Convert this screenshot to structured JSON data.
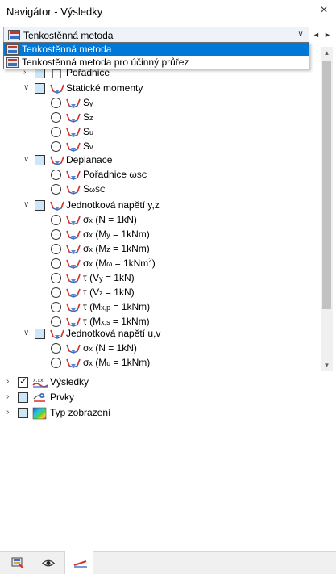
{
  "window": {
    "title": "Navigátor - Výsledky",
    "close_glyph": "×"
  },
  "combo": {
    "selected": "Tenkostěnná metoda",
    "dropdown_glyph": "∨",
    "prev_glyph": "◄",
    "next_glyph": "►"
  },
  "dropdown": {
    "options": [
      {
        "label": "Tenkostěnná metoda",
        "selected": true
      },
      {
        "label": "Tenkostěnná metoda pro účinný průřez",
        "selected": false
      }
    ]
  },
  "tree": {
    "poradnice": "Pořadnice",
    "staticke_momenty": {
      "label": "Statické momenty",
      "items": [
        {
          "main": "S",
          "sub": "y"
        },
        {
          "main": "S",
          "sub": "z"
        },
        {
          "main": "S",
          "sub": "u"
        },
        {
          "main": "S",
          "sub": "v"
        }
      ]
    },
    "deplanace": {
      "label": "Deplanace",
      "items": [
        {
          "text": "Pořadnice ω",
          "sub": "SC"
        },
        {
          "text": "S",
          "sub": "ωSC"
        }
      ]
    },
    "jednotkova_yz": {
      "label": "Jednotková napětí y,z",
      "items": [
        {
          "pre": "σ",
          "psub": "x",
          "a": " (N = 1kN)",
          "asub": "",
          "b": ""
        },
        {
          "pre": "σ",
          "psub": "x",
          "a": " (M",
          "asub": "y",
          "b": " = 1kNm)"
        },
        {
          "pre": "σ",
          "psub": "x",
          "a": " (M",
          "asub": "z",
          "b": " = 1kNm)"
        },
        {
          "pre": "σ",
          "psub": "x",
          "a": " (M",
          "asub": "ω",
          "b": " = 1kNm",
          "sup": "2",
          "c": ")"
        },
        {
          "pre": "τ",
          "psub": "",
          "a": " (V",
          "asub": "y",
          "b": " = 1kN)"
        },
        {
          "pre": "τ",
          "psub": "",
          "a": " (V",
          "asub": "z",
          "b": " = 1kN)"
        },
        {
          "pre": "τ",
          "psub": "",
          "a": " (M",
          "asub": "x,p",
          "b": " = 1kNm)"
        },
        {
          "pre": "τ",
          "psub": "",
          "a": " (M",
          "asub": "x,s",
          "b": " = 1kNm)"
        }
      ]
    },
    "jednotkova_uv": {
      "label": "Jednotková napětí u,v",
      "items": [
        {
          "pre": "σ",
          "psub": "x",
          "a": " (N = 1kN)",
          "asub": "",
          "b": ""
        },
        {
          "pre": "σ",
          "psub": "x",
          "a": " (M",
          "asub": "u",
          "b": " = 1kNm)"
        }
      ]
    }
  },
  "root_items": [
    {
      "label": "Výsledky",
      "checked": true,
      "icon": "results-icon",
      "icon_text": "x.xx"
    },
    {
      "label": "Prvky",
      "checked": false,
      "icon": "elements-icon"
    },
    {
      "label": "Typ zobrazení",
      "checked": false,
      "icon": "display-type-icon"
    }
  ],
  "tabs": [
    {
      "name": "data-tab",
      "active": false
    },
    {
      "name": "view-tab",
      "active": false
    },
    {
      "name": "results-tab",
      "active": true
    }
  ],
  "colors": {
    "accent": "#0078d7",
    "checkbox_fill": "#cde7f7",
    "stress_icon": "#d9302c",
    "stress_icon_blue": "#3a6fc4"
  }
}
